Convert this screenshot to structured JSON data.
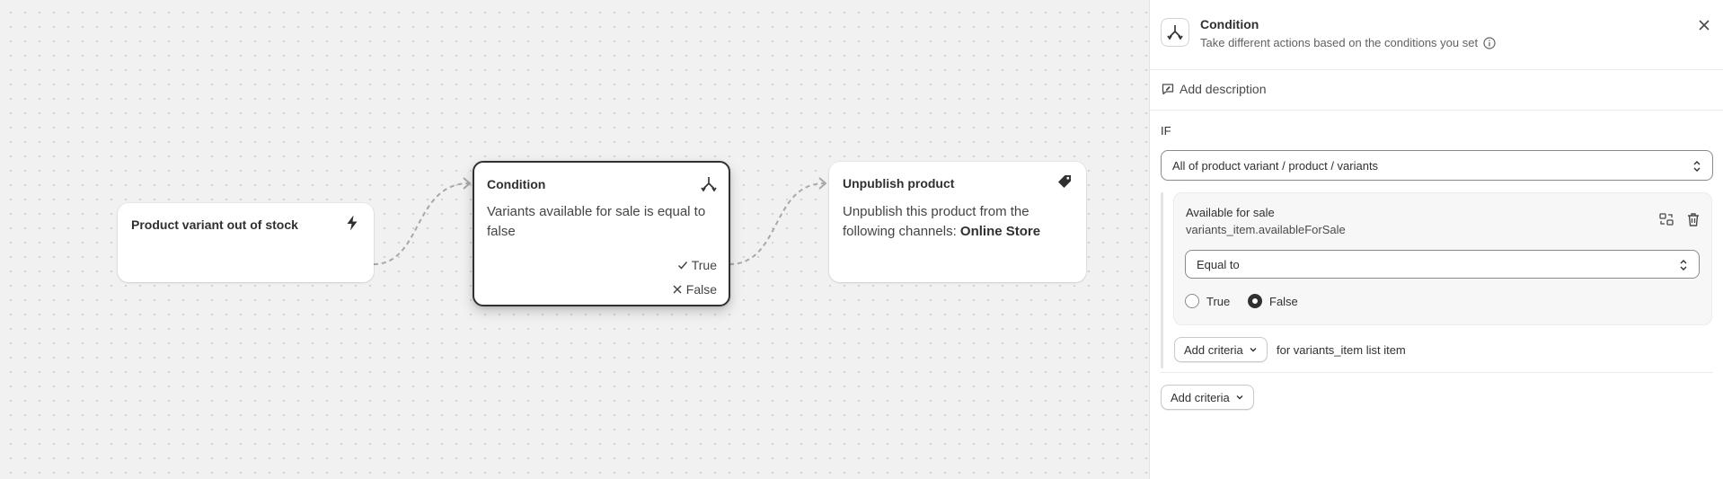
{
  "canvas": {
    "trigger": {
      "title": "Product variant out of stock",
      "icon": "lightning-bolt-icon"
    },
    "condition": {
      "title": "Condition",
      "icon": "branch-icon",
      "body": "Variants available for sale is equal to false",
      "true_label": "True",
      "false_label": "False"
    },
    "action": {
      "title": "Unpublish product",
      "icon": "tag-icon",
      "body_prefix": "Unpublish this product from the following channels: ",
      "body_strong": "Online Store"
    }
  },
  "panel": {
    "title": "Condition",
    "subtitle": "Take different actions based on the conditions you set",
    "add_description": "Add description",
    "if_label": "IF",
    "scope_select": "All of product variant / product / variants",
    "criteria": {
      "label": "Available for sale",
      "variable": "variants_item.availableForSale",
      "operator": "Equal to",
      "options": [
        {
          "label": "True",
          "checked": false
        },
        {
          "label": "False",
          "checked": true
        }
      ]
    },
    "add_criteria_inner": "Add criteria",
    "add_criteria_inner_suffix": "for variants_item list item",
    "add_criteria_outer": "Add criteria"
  },
  "colors": {
    "canvas_bg": "#f1f1f1",
    "text": "#303030",
    "selected_border": "#303030"
  }
}
